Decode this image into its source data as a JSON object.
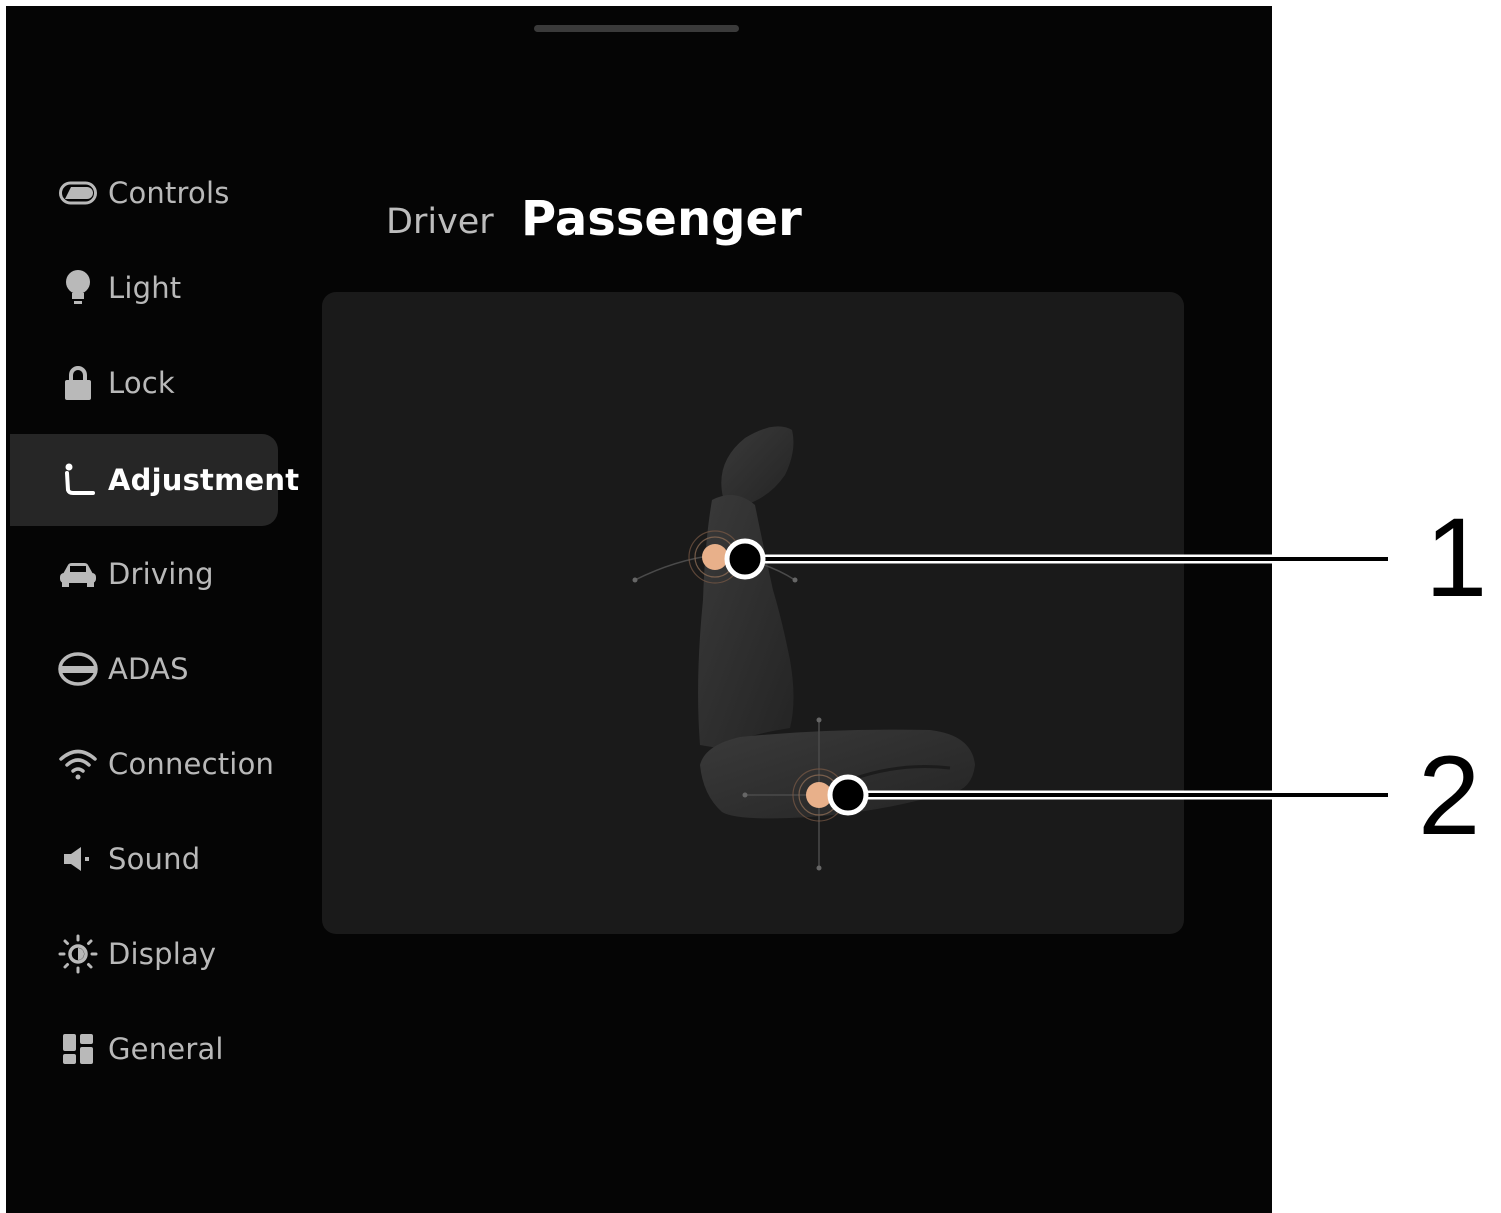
{
  "sidebar": {
    "items": [
      {
        "label": "Controls",
        "icon": "toggle-icon"
      },
      {
        "label": "Light",
        "icon": "bulb-icon"
      },
      {
        "label": "Lock",
        "icon": "lock-icon"
      },
      {
        "label": "Adjustment",
        "icon": "seat-icon",
        "active": true
      },
      {
        "label": "Driving",
        "icon": "car-icon"
      },
      {
        "label": "ADAS",
        "icon": "adas-icon"
      },
      {
        "label": "Connection",
        "icon": "wifi-icon"
      },
      {
        "label": "Sound",
        "icon": "speaker-icon"
      },
      {
        "label": "Display",
        "icon": "brightness-icon"
      },
      {
        "label": "General",
        "icon": "grid-icon"
      }
    ]
  },
  "tabs": {
    "driver": "Driver",
    "passenger": "Passenger",
    "selected": "Passenger"
  },
  "seat": {
    "hotspot_color": "#e8b08a"
  },
  "callouts": {
    "one": "1",
    "two": "2"
  }
}
